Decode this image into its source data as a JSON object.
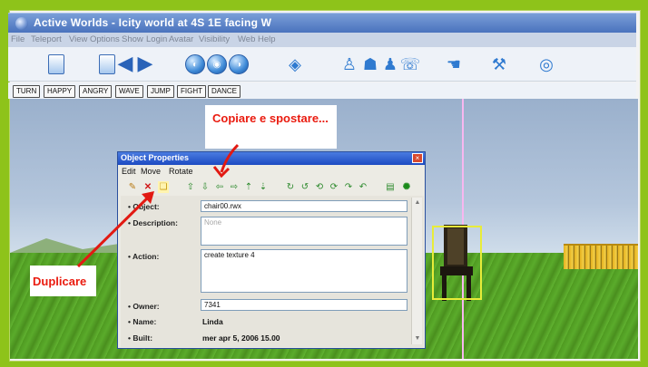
{
  "window": {
    "title": "Active Worlds - Icity world at 4S 1E facing W"
  },
  "menu": [
    "File",
    "Teleport",
    "View",
    "Options",
    "Show",
    "Login",
    "Avatar",
    "Visibility",
    "Web",
    "Help"
  ],
  "toolbar_icons": [
    "home-icon",
    "back-arrow-icon",
    "forward-arrow-icon",
    "camera-icon",
    "zoom-icon",
    "view-icon",
    "eye-icon",
    "people-icon",
    "chat-icon",
    "group-icon",
    "tools-icon",
    "hand-icon",
    "build-icon",
    "globe-icon"
  ],
  "gestures": [
    "TURN",
    "HAPPY",
    "ANGRY",
    "WAVE",
    "JUMP",
    "FIGHT",
    "DANCE"
  ],
  "callouts": {
    "top": "Copiare e spostare...",
    "left": "Duplicare"
  },
  "dialog": {
    "title": "Object Properties",
    "close": "×",
    "menu": [
      "Edit",
      "Move",
      "Rotate"
    ],
    "fields": {
      "object": {
        "label": "Object:",
        "value": "chair00.rwx"
      },
      "description": {
        "label": "Description:",
        "value": "None"
      },
      "action": {
        "label": "Action:",
        "value": "create texture 4"
      },
      "owner": {
        "label": "Owner:",
        "value": "7341"
      },
      "name": {
        "label": "Name:",
        "value": "Linda"
      },
      "built": {
        "label": "Built:",
        "value": "mer apr 5, 2006 15.00"
      }
    }
  },
  "colors": {
    "frame": "#8ec31a",
    "callout_text": "#ea1b0f",
    "titlebar": "#4a73bd"
  }
}
